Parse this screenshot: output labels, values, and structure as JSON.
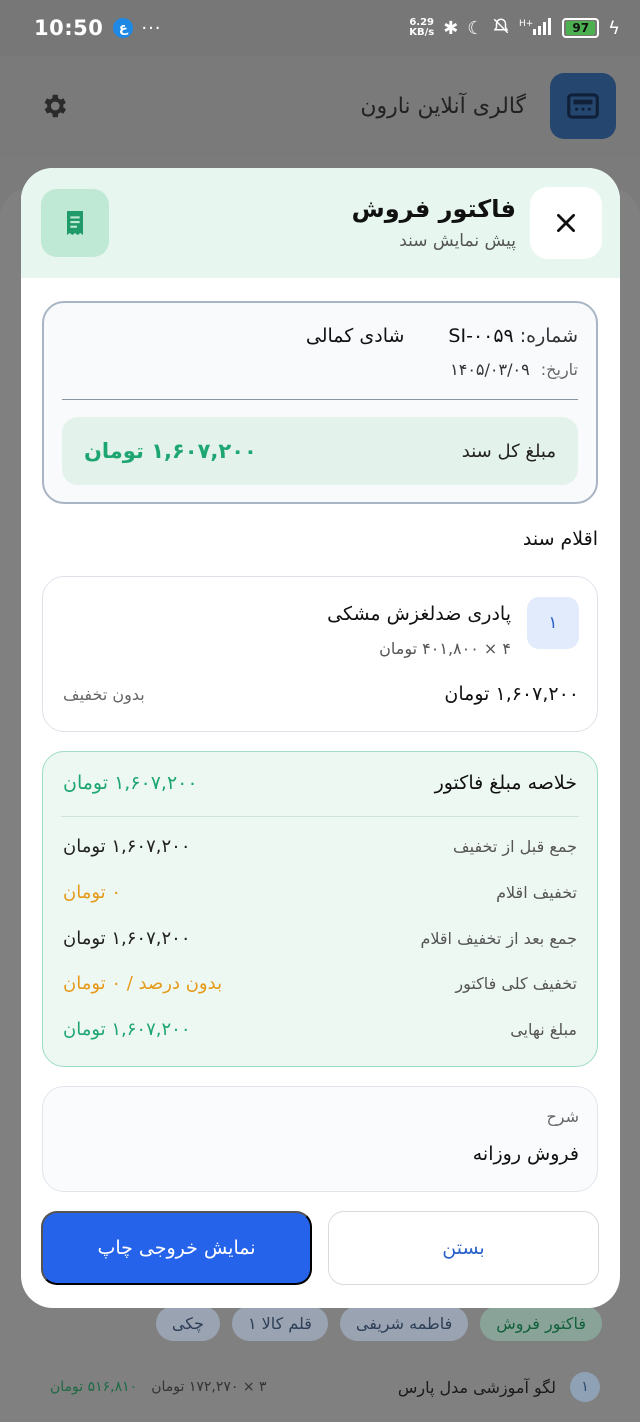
{
  "status_bar": {
    "time": "10:50",
    "notif_letter": "ع",
    "dots": "···",
    "net_speed": "6.29",
    "net_unit": "KB/s",
    "battery": "97"
  },
  "app_bar": {
    "title": "گالری آنلاین نارون"
  },
  "background": {
    "chips": [
      "فاکتور فروش",
      "فاطمه شریفی",
      "۱ قلم کالا",
      "چکی"
    ],
    "row": {
      "num": "۱",
      "name": "لگو آموزشی مدل پارس",
      "qty": "۳ × ۱۷۲,۲۷۰ تومان",
      "price": "۵۱۶,۸۱۰ تومان"
    }
  },
  "modal": {
    "title": "فاکتور فروش",
    "subtitle": "پیش نمایش سند",
    "info": {
      "number_label": "شماره:",
      "number": "SI-۰۰۵۹",
      "customer": "شادی کمالی",
      "date_label": "تاریخ:",
      "date": "۱۴۰۵/۰۳/۰۹",
      "total_label": "مبلغ کل سند",
      "total": "۱,۶۰۷,۲۰۰ تومان"
    },
    "items_title": "اقلام سند",
    "item": {
      "num": "۱",
      "name": "پادری ضدلغزش مشکی",
      "qty": "۴ × ۴۰۱,۸۰۰ تومان",
      "total": "۱,۶۰۷,۲۰۰ تومان",
      "discount": "بدون تخفیف"
    },
    "summary": {
      "title": "خلاصه مبلغ فاکتور",
      "title_amount": "۱,۶۰۷,۲۰۰ تومان",
      "rows": [
        {
          "label": "جمع قبل از تخفیف",
          "value": "۱,۶۰۷,۲۰۰ تومان"
        },
        {
          "label": "تخفیف اقلام",
          "value": "۰ تومان"
        },
        {
          "label": "جمع بعد از تخفیف اقلام",
          "value": "۱,۶۰۷,۲۰۰ تومان"
        },
        {
          "label": "تخفیف کلی فاکتور",
          "value": "بدون درصد / ۰ تومان"
        },
        {
          "label": "مبلغ نهایی",
          "value": "۱,۶۰۷,۲۰۰ تومان"
        }
      ]
    },
    "description": {
      "label": "شرح",
      "value": "فروش روزانه"
    },
    "buttons": {
      "close": "بستن",
      "print": "نمایش خروجی چاپ"
    }
  },
  "colors": {
    "accent_green": "#1ea672",
    "accent_blue": "#2563eb",
    "warning_orange": "#e69a1a",
    "header_mint": "#e7f6ef"
  }
}
